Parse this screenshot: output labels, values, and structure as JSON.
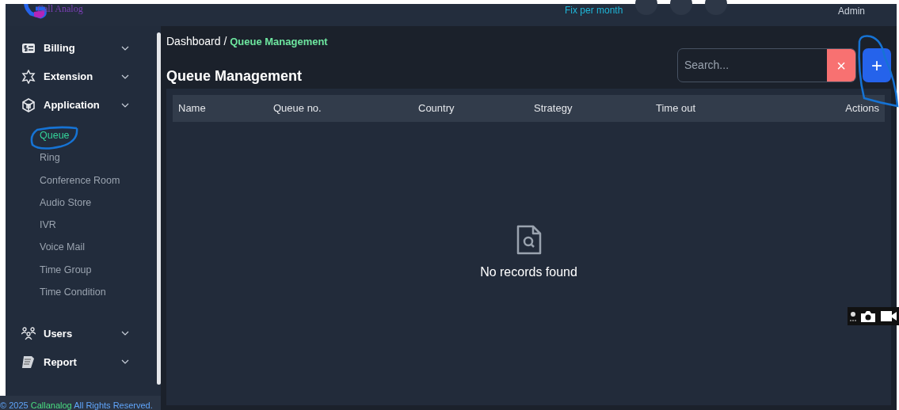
{
  "logo": {
    "text": "Call Analog"
  },
  "topbar": {
    "plan": "Fix per month",
    "user": "Admin"
  },
  "sidebar": {
    "items": [
      {
        "label": "Billing"
      },
      {
        "label": "Extension"
      },
      {
        "label": "Application",
        "children": [
          {
            "label": "Queue",
            "selected": true
          },
          {
            "label": "Ring",
            "selected": false
          },
          {
            "label": "Conference Room",
            "selected": false
          },
          {
            "label": "Audio Store",
            "selected": false
          },
          {
            "label": "IVR",
            "selected": false
          },
          {
            "label": "Voice Mail",
            "selected": false
          },
          {
            "label": "Time Group",
            "selected": false
          },
          {
            "label": "Time Condition",
            "selected": false
          }
        ]
      },
      {
        "label": "Users"
      },
      {
        "label": "Report"
      }
    ]
  },
  "footer": {
    "before": "© 2025 ",
    "brand": "Callanalog",
    "after": " All Rights Reserved."
  },
  "breadcrumb": [
    {
      "label": "Dashboard",
      "selected": false
    },
    {
      "label": "Queue Management",
      "selected": true
    }
  ],
  "breadcrumb_separator": "/",
  "title": "Queue Management",
  "search": {
    "placeholder": "Search..."
  },
  "clear_button": "×",
  "add_button": "+",
  "table": {
    "columns": [
      "Name",
      "Queue no.",
      "Country",
      "Strategy",
      "Time out",
      "Actions"
    ],
    "empty_text": "No records found"
  }
}
